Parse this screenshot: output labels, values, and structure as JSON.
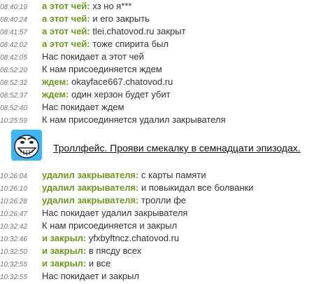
{
  "colors": {
    "nick": "#6a9a20",
    "timestamp": "#777777",
    "text": "#333333",
    "link": "#111111"
  },
  "messages_top": [
    {
      "time": "08:40:19",
      "nick": "а этот чей:",
      "text": " хз но я***"
    },
    {
      "time": "08:40:24",
      "nick": "а этот чей:",
      "text": " и его закрыть"
    },
    {
      "time": "08:41:57",
      "nick": "а этот чей:",
      "text": " tlei.chatovod.ru закрыт"
    },
    {
      "time": "08:42:02",
      "nick": "а этот чей:",
      "text": " тоже спирита был"
    },
    {
      "time": "08:42:05",
      "nick": "",
      "text": "Нас покидает а этот чей"
    },
    {
      "time": "08:52:20",
      "nick": "",
      "text": "К нам присоединяется ждем"
    },
    {
      "time": "08:52:32",
      "nick": "ждем:",
      "text": " okayface667.chatovod.ru"
    },
    {
      "time": "08:52:37",
      "nick": "ждем:",
      "text": " один херзон будет убит"
    },
    {
      "time": "08:52:40",
      "nick": "",
      "text": "Нас покидает ждем"
    },
    {
      "time": "10:25:59",
      "nick": "",
      "text": "К нам присоединяется удалил закрывателя"
    }
  ],
  "ad": {
    "icon": "trollface-icon",
    "link_text": "Троллфейс. Прояви смекалку в семнадцати эпизодах."
  },
  "messages_bottom": [
    {
      "time": "10:26:04",
      "nick": "удалил закрывателя:",
      "text": " с карты памяти"
    },
    {
      "time": "10:26:10",
      "nick": "удалил закрывателя:",
      "text": " и повыкидал все болванки"
    },
    {
      "time": "10:26:28",
      "nick": "удалил закрывателя:",
      "text": " тролли фе"
    },
    {
      "time": "10:26:47",
      "nick": "",
      "text": "Нас покидает удалил закрывателя"
    },
    {
      "time": "10:32:42",
      "nick": "",
      "text": "К нам присоединяется и закрыл"
    },
    {
      "time": "10:32:46",
      "nick": "и закрыл:",
      "text": " yfxbyftncz.chatovod.ru"
    },
    {
      "time": "10:32:50",
      "nick": "и закрыл:",
      "text": " в пясду всех"
    },
    {
      "time": "10:32:55",
      "nick": "и закрыл:",
      "text": " и все"
    },
    {
      "time": "10:32:55",
      "nick": "",
      "text": "Нас покидает и закрыл"
    }
  ]
}
